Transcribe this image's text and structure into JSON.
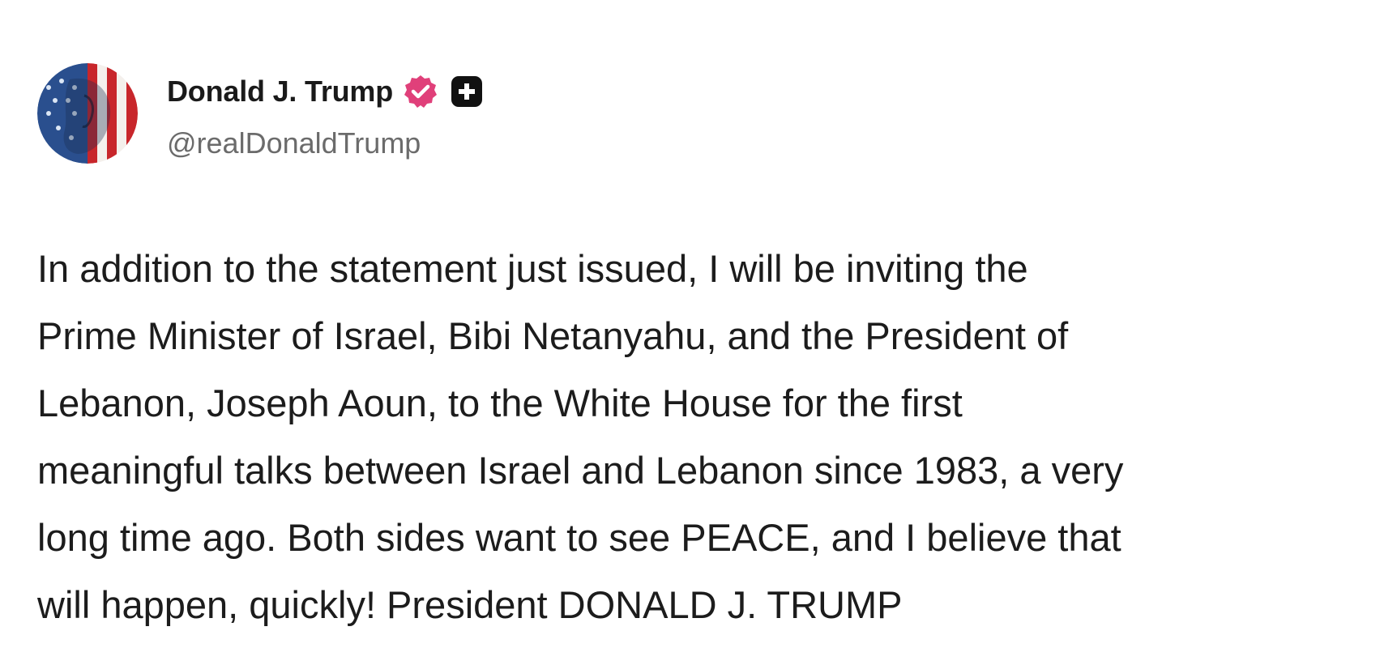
{
  "author": {
    "display_name": "Donald J. Trump",
    "handle": "@realDonaldTrump",
    "avatar_icon": "flag-portrait-avatar",
    "verified_icon": "verified-badge-icon",
    "verified_color": "#e0407a",
    "extra_badge_icon": "plus-square-icon",
    "extra_badge_color": "#111111"
  },
  "post": {
    "text": "In addition to the statement just issued, I will be inviting the\nPrime Minister of Israel, Bibi Netanyahu, and the President of\nLebanon, Joseph Aoun, to the White House for the first\nmeaningful talks between Israel and Lebanon since 1983, a very\nlong time ago. Both sides want to see PEACE, and I believe that\nwill happen, quickly! President DONALD J. TRUMP"
  }
}
